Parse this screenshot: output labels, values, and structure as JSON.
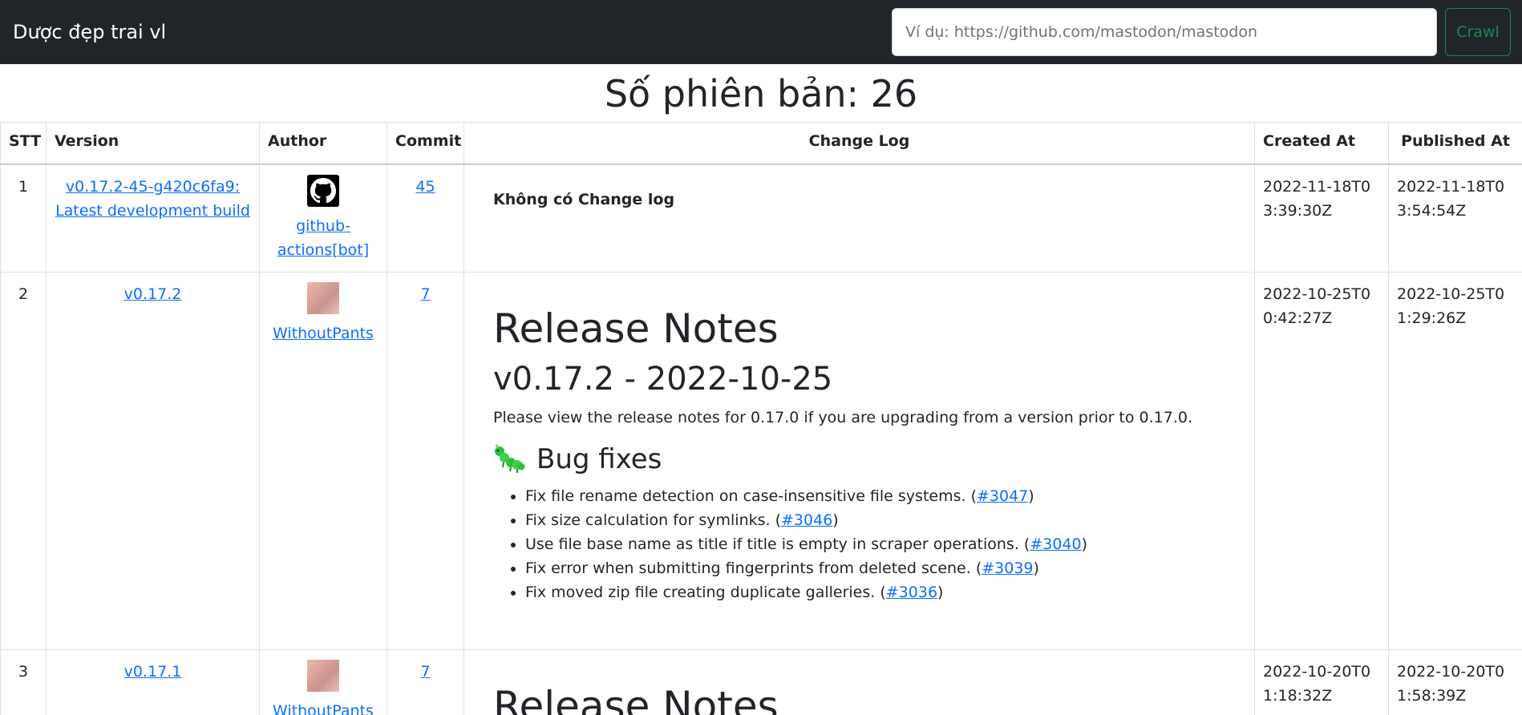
{
  "navbar": {
    "brand": "Dược đẹp trai vl",
    "search_placeholder": "Ví dụ: https://github.com/mastodon/mastodon",
    "crawl_label": "Crawl",
    "crawl_color": "#198754"
  },
  "heading": {
    "title": "Số phiên bản: 26"
  },
  "table": {
    "headers": {
      "stt": "STT",
      "version": "Version",
      "author": "Author",
      "commit": "Commit",
      "changelog": "Change Log",
      "created": "Created At",
      "published": "Published At"
    },
    "rows": [
      {
        "stt": "1",
        "version": "v0.17.2-45-g420c6fa9: Latest development build",
        "author_icon": "github-logo-icon",
        "author": "github-actions[bot]",
        "commit": "45",
        "changelog_empty": "Không có Change log",
        "created": "2022-11-18T03:39:30Z",
        "published": "2022-11-18T03:54:54Z"
      },
      {
        "stt": "2",
        "version": "v0.17.2",
        "author_icon": "avatar-icon",
        "author": "WithoutPants",
        "commit": "7",
        "notes": {
          "title": "Release Notes",
          "subtitle": "v0.17.2 - 2022-10-25",
          "intro": "Please view the release notes for 0.17.0 if you are upgrading from a version prior to 0.17.0.",
          "section_icon": "caterpillar-bug-icon",
          "section_title": "Bug fixes",
          "items": [
            {
              "text": "Fix file rename detection on case-insensitive file systems. (",
              "link": "#3047",
              "after": ")"
            },
            {
              "text": "Fix size calculation for symlinks. (",
              "link": "#3046",
              "after": ")"
            },
            {
              "text": "Use file base name as title if title is empty in scraper operations. (",
              "link": "#3040",
              "after": ")"
            },
            {
              "text": "Fix error when submitting fingerprints from deleted scene. (",
              "link": "#3039",
              "after": ")"
            },
            {
              "text": "Fix moved zip file creating duplicate galleries. (",
              "link": "#3036",
              "after": ")"
            }
          ]
        },
        "created": "2022-10-25T00:42:27Z",
        "published": "2022-10-25T01:29:26Z"
      },
      {
        "stt": "3",
        "version": "v0.17.1",
        "author_icon": "avatar-icon",
        "author": "WithoutPants",
        "commit": "7",
        "notes": {
          "title": "Release Notes"
        },
        "created": "2022-10-20T01:18:32Z",
        "published": "2022-10-20T01:58:39Z"
      }
    ]
  }
}
